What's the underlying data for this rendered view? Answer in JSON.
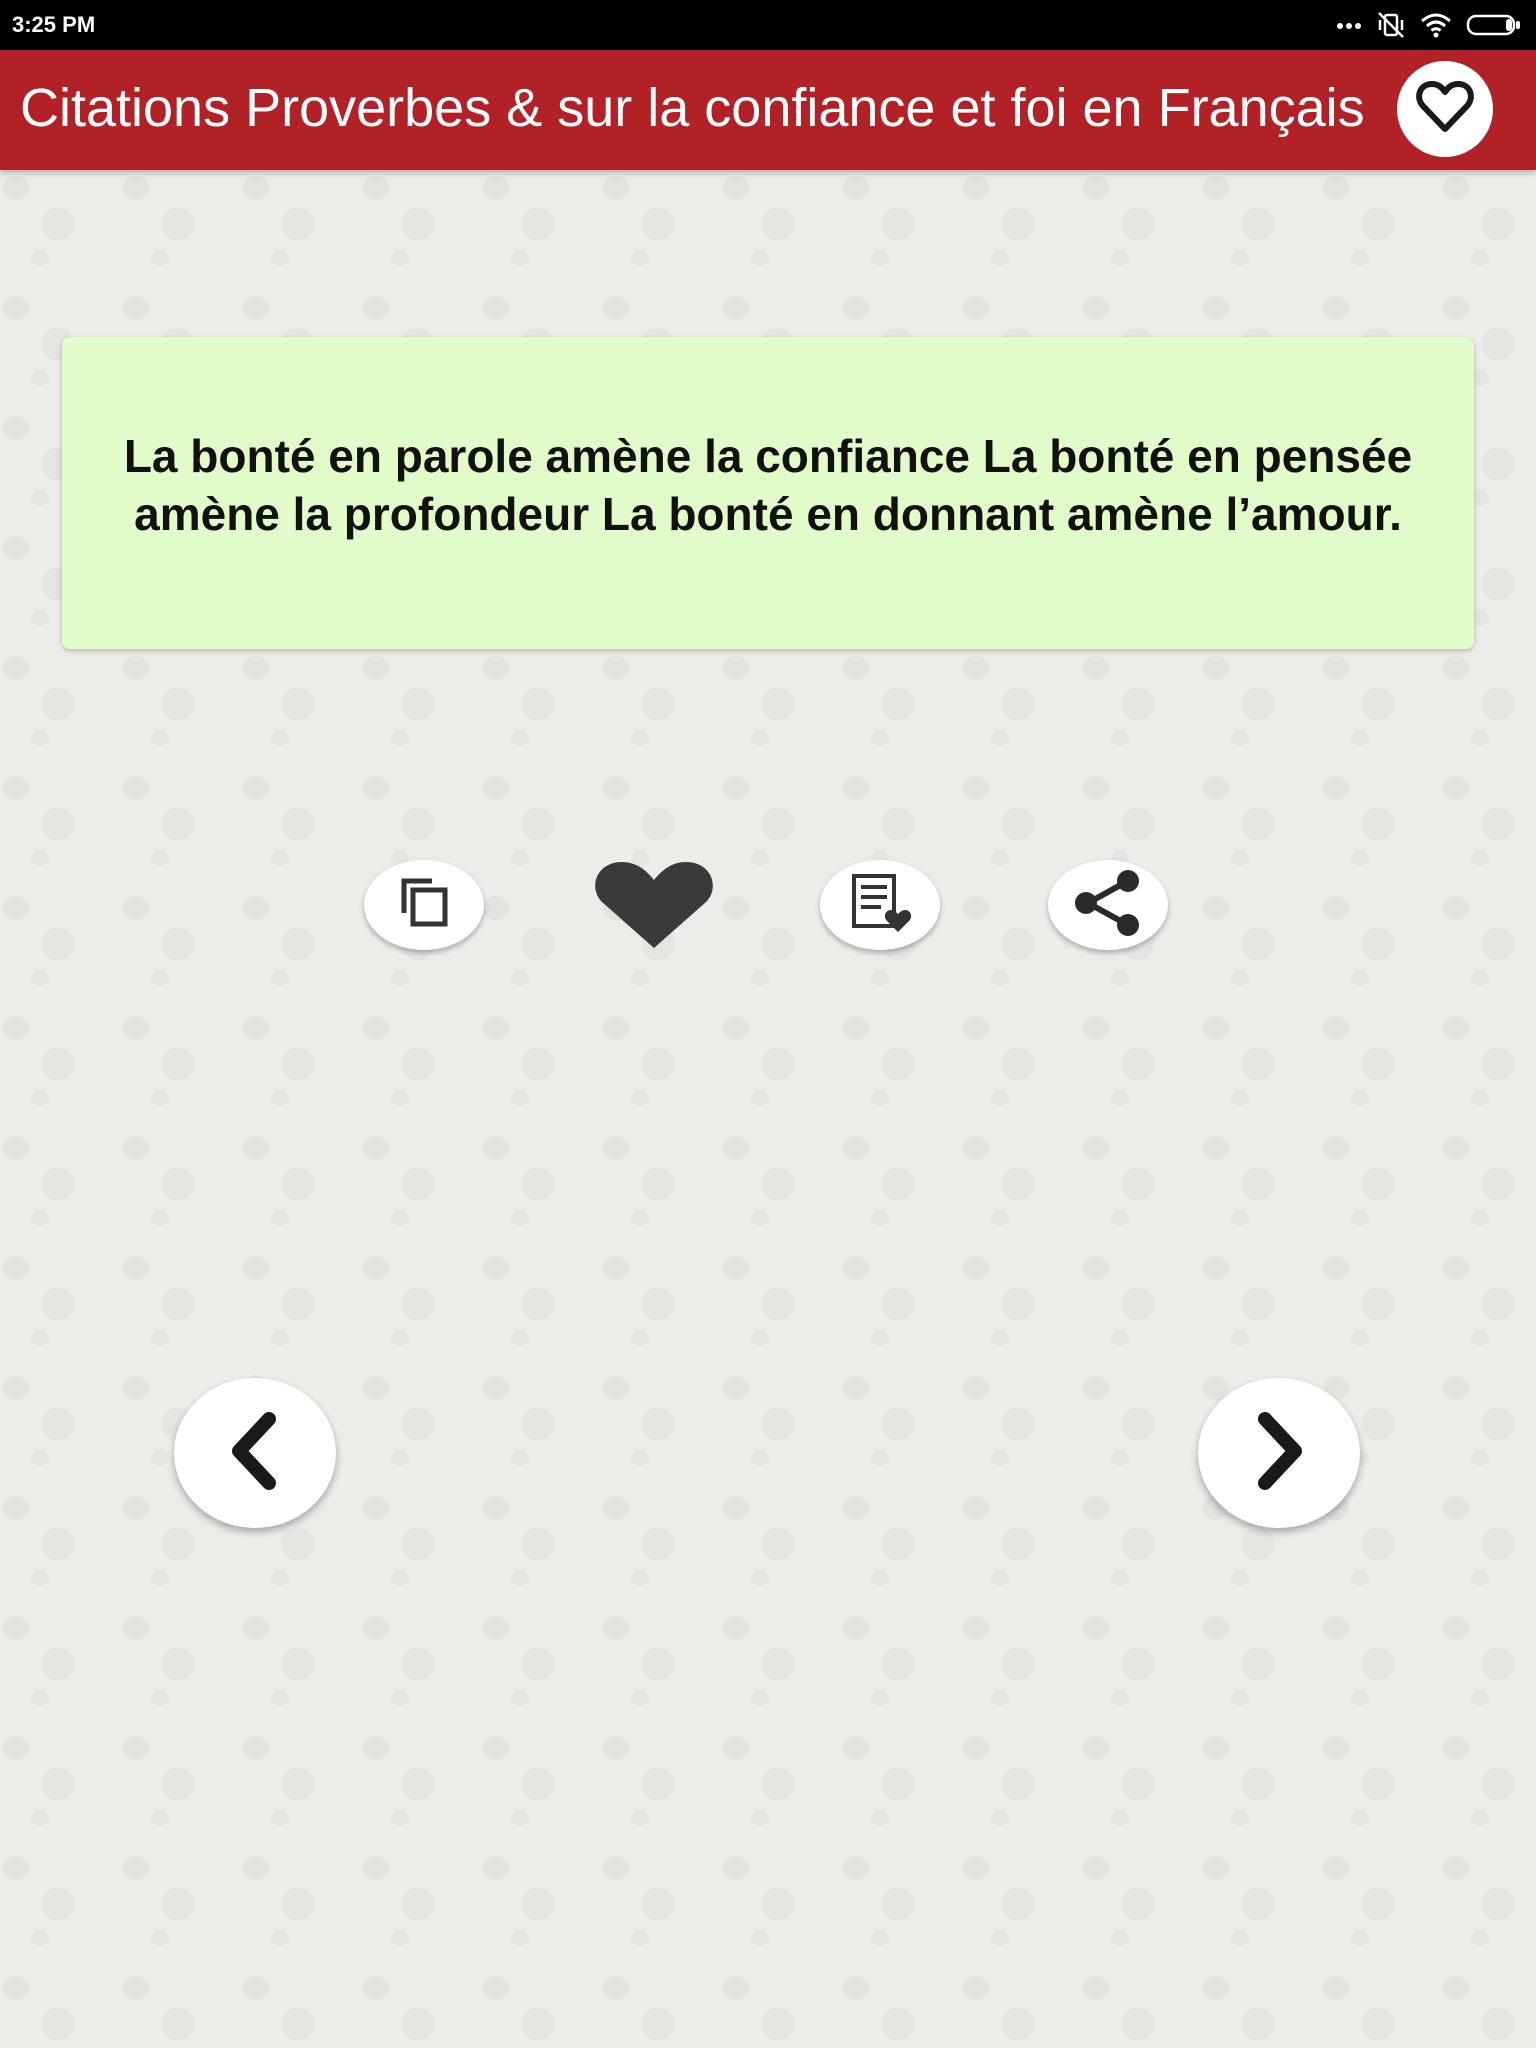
{
  "status_bar": {
    "time": "3:25 PM",
    "icons": [
      "more-dots-icon",
      "vibrate-muted-icon",
      "wifi-icon",
      "battery-icon"
    ]
  },
  "app_bar": {
    "title": "Citations Proverbes & sur la confiance et foi en Français",
    "favorites_icon": "heart-outline-icon",
    "color": "#b12126"
  },
  "quote": {
    "text": "La bonté en parole amène la confiance La bonté en pensée amène la profondeur La bonté en donnant amène l’amour.",
    "card_color": "#e1fcc9"
  },
  "actions": [
    {
      "name": "copy",
      "icon": "copy-icon"
    },
    {
      "name": "favorite",
      "icon": "heart-filled-icon"
    },
    {
      "name": "favorites-list",
      "icon": "list-heart-icon"
    },
    {
      "name": "share",
      "icon": "share-icon"
    }
  ],
  "navigation": {
    "previous_icon": "chevron-left-icon",
    "next_icon": "chevron-right-icon"
  }
}
